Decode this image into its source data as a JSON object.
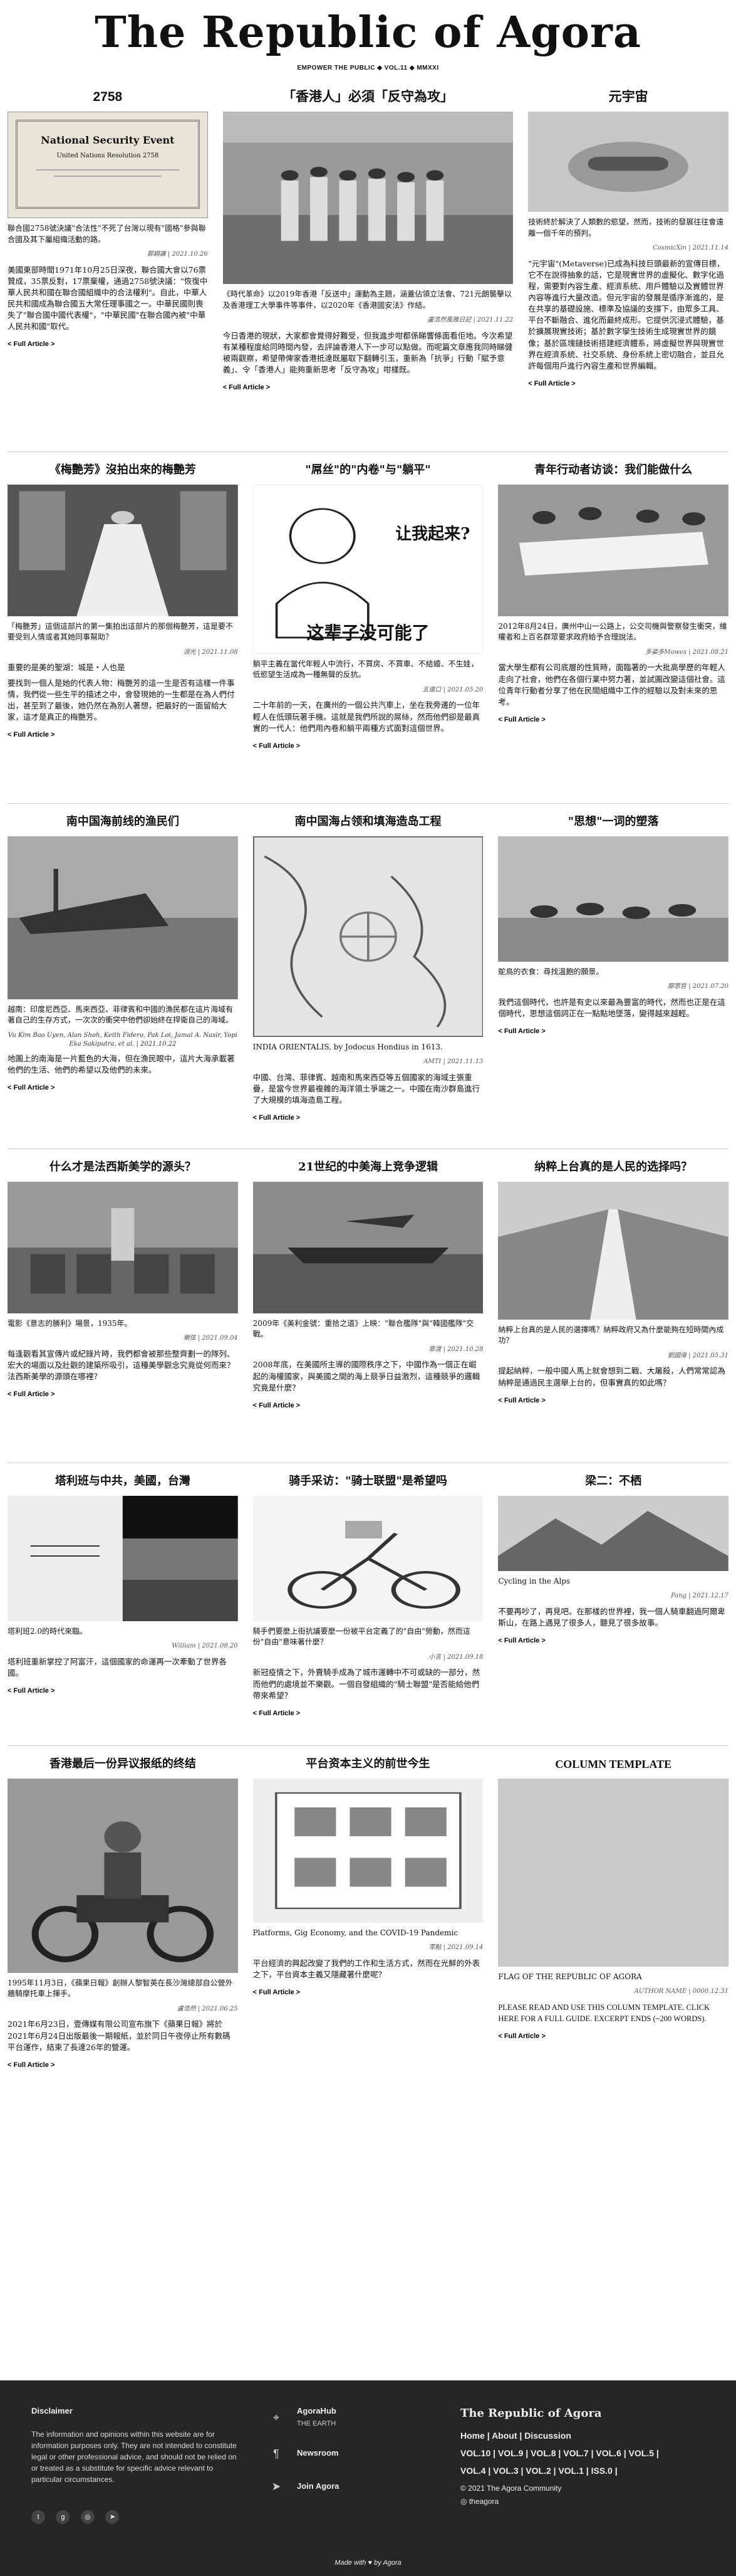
{
  "masthead": {
    "title": "The Republic of Agora",
    "subtitle": "EMPOWER THE PUBLIC ◆ VOL.11 ◆ MMXXI"
  },
  "row1": {
    "left": {
      "title": "2758",
      "image_text": "National Security Event",
      "image_sub": "United Nations Resolution 2758",
      "caption": "聯合國2758號決議\"合法性\"不死了台灣以現有\"國格\"參與聯合國及其下屬組織活動的路。",
      "meta": "鄭穎謙 | 2021.10.26",
      "body": "美國東部時間1971年10月25日深夜，聯合國大會以76票贊成，35票反對，17票棄權，通過2758號決議：\"恢復中華人民共和國在聯合國組織中的合法權利\"。自此，中華人民共和國成為聯合國五大常任理事國之一。中華民國則喪失了\"聯合國中國代表權\"，\"中華民國\"在聯合國內被\"中華人民共和國\"取代。"
    },
    "mid": {
      "title": "「香港人」必須「反守為攻」",
      "caption": "《時代革命》以2019年香港「反送中」運動為主題，涵蓋佔領立法會、721元朗襲擊以及香港理工大學事件等事件，以2020年《香港國安法》作結。",
      "meta": "盧浩然風雅日記 | 2021.11.22",
      "body": "今日香港的現狀，大家都會覺得好難受，但我進步咁都係睇響條面看佢地。今次希望有某種程度給同時間內發，去評論香港人下一步可以點做。而呢篇文章應我同時睇健被兩觀察，希望帶俾家香港抵達既屬取下翻轉引玉，重新為「抗爭」行動「賦予意義」、令「香港人」能夠重新思考「反守為攻」咁樣既。"
    },
    "right": {
      "title": "元宇宙",
      "caption": "技術終於解決了人類數的慾望，然而，技術的發展往往會遠離一個千年的預判。",
      "meta": "CosmicXin | 2021.11.14",
      "body": "\"元宇宙\"(Metaverse)已成為科技巨頭最新的宣傳目標，它不在說得抽象的話，它是現實世界的虛擬化、數字化過程，需要對內容生產、經濟系統、用戶體驗以及實體世界內容等進行大量改造。但元宇宙的發展是循序漸進的，是在共享的基礎設施、標準及協議的支撐下，由眾多工具、平台不斷融合、進化而最終成形。它提供沉浸式體驗，基於擴展現實技術；基於數字孿生技術生成現實世界的鏡像；基於區塊鏈技術搭建經濟體系，將虛擬世界與現實世界在經濟系統、社交系統、身份系統上密切融合，並且允許每個用戶進行內容生產和世界編輯。"
    },
    "full": "< Full Article >"
  },
  "row2": {
    "left": {
      "title": "《梅艷芳》沒拍出來的梅艷芳",
      "caption": "「梅艷芳」這個這部片的第一集拍出這部片的那個梅艷芳，這是要不要受到人情或者其她同事幫助？",
      "meta": "淚光 | 2021.11.08",
      "sub": "重要的是美的聖湖：城是・人也是",
      "body": "要找到一個人是她的代表人物：梅艷芳的這一生是否有這樣一件事情，我們從一些生平的描述之中，會發現她的一生都是在為人們付出，甚至到了最後，她仍然在為別人著想，把最好的一面留給大家，這才是真正的梅艷芳。"
    },
    "mid": {
      "title": "\"屌丝\"的\"内卷\"与\"躺平\"",
      "img_text1": "让我起来?",
      "img_text2": "这辈子没可能了",
      "caption": "躺平主義在當代年輕人中流行，不買房、不買車、不結婚、不生娃，低慾望生活成為一種無聲的反抗。",
      "meta": "五道口 | 2021.05.20",
      "body": "二十年前的一天，在廣州的一個公共汽車上，坐在我旁邊的一位年輕人在低頭玩著手機。這就是我們所說的屌絲，然而他們卻是最真實的一代人：他們用內卷和躺平兩種方式面對這個世界。"
    },
    "right": {
      "title": "青年行动者访谈：我们能做什么",
      "caption": "2012年8月24日，廣州中山一公路上，公交司機與警察發生衝突，維權者和上百名群眾要求政府給予合理說法。",
      "meta": "多姿多Mowes | 2021.08.21",
      "body": "當大學生都有公司底層的性質時，面臨著的一大批高學歷的年輕人走向了社會，他們在各個行業中努力著，並試圖改變這個社會。這位青年行動者分享了他在民間組織中工作的經驗以及對未來的思考。"
    },
    "full": "< Full Article >"
  },
  "row3": {
    "left": {
      "title": "南中国海前线的渔民们",
      "caption": "越南：印度尼西亞、馬來西亞、菲律賓和中國的漁民都在這片海域有著自己的生存方式，一次次的衝突中他們卻始終在捍衛自己的海域。",
      "meta": "Vu Kim Bao Uyen, Alan Shoh, Keith Fidero, Pak Loi, Jamal A. Nasir, Yopi Eka Sakiputra, et al. | 2021.10.22",
      "body": "地圖上的南海是一片藍色的大海，但在漁民眼中，這片大海承載著他們的生活、他們的希望以及他們的未來。"
    },
    "mid": {
      "title": "南中国海占领和填海造岛工程",
      "caption": "INDIA ORIENTALIS, by Jodocus Hondius in 1613.",
      "meta": "AMTI | 2021.11.13",
      "body": "中國、台灣、菲律賓、越南和馬來西亞等五個國家的海域主張重疊，是當今世界最複雜的海洋領土爭端之一。中國在南沙群島進行了大規模的填海造島工程。"
    },
    "right": {
      "title": "\"思想\"一词的塑落",
      "caption": "鴕鳥的衣食：尋找溫飽的願景。",
      "meta": "鄒思哲 | 2021.07.20",
      "body": "我們這個時代，也許是有史以來最為豐富的時代，然而也正是在這個時代，思想這個詞正在一點點地墜落，變得越來越輕。"
    },
    "full": "< Full Article >"
  },
  "row4": {
    "left": {
      "title": "什么才是法西斯美学的源头？",
      "caption": "電影《意志的勝利》場景，1935年。",
      "meta": "樂弦 | 2021.09.04",
      "body": "每逢觀看其宣傳片或紀錄片時，我們都會被那些整齊劃一的隊列、宏大的場面以及壯觀的建築所吸引，這種美學觀念究竟從何而來？法西斯美學的源頭在哪裡？"
    },
    "mid": {
      "title": "21世纪的中美海上竞争逻辑",
      "caption": "2009年《美利金號：重拾之道》上映：\"聯合艦隊\"與\"韓國艦隊\"交戰。",
      "meta": "章渡 | 2021.10.28",
      "body": "2008年底，在美國所主導的國際秩序之下，中國作為一個正在崛起的海權國家，與美國之間的海上競爭日益激烈，這種競爭的邏輯究竟是什麼？"
    },
    "right": {
      "title": "纳粹上台真的是人民的选择吗？",
      "caption": "納粹上台真的是人民的選擇嗎？納粹政府又為什麼能夠在短時間內成功？",
      "meta": "劉國偉 | 2021.05.31",
      "body": "提起納粹，一般中國人馬上就會想到二戰、大屠殺，人們常常認為納粹是通過民主選舉上台的，但事實真的如此嗎？"
    },
    "full": "< Full Article >"
  },
  "row5": {
    "left": {
      "title": "塔利班与中共，美國，台灣",
      "caption": "塔利班2.0的時代來臨。",
      "meta": "William | 2021.08.20",
      "body": "塔利班重新掌控了阿富汗，這個國家的命運再一次牽動了世界各國。"
    },
    "mid": {
      "title": "骑手采访：\"骑士联盟\"是希望吗",
      "caption": "騎手們要麼上街抗議要麼一份被平台定義了的\"自由\"勞動，然而這份\"自由\"意味著什麼？",
      "meta": "小言 | 2021.09.18",
      "body": "新冠疫情之下，外賣騎手成為了城市運轉中不可或缺的一部分，然而他們的處境並不樂觀。一個自發組織的\"騎士聯盟\"是否能給他們帶來希望？"
    },
    "right": {
      "title": "梁二：不栖",
      "caption": "Cycling in the Alps",
      "meta": "Pang | 2021.12.17",
      "body": "不要再吵了，再見吧。在那樣的世界裡，我一個人騎車翻過阿爾卑斯山，在路上遇見了很多人，聽見了很多故事。"
    },
    "full": "< Full Article >"
  },
  "row6": {
    "left": {
      "title": "香港最后一份异议报纸的终结",
      "caption": "1995年11月3日，《蘋果日報》創辦人黎智英在長沙灣總部自公營外牆騎摩托車上揮手。",
      "meta": "盧浩然 | 2021.06.25",
      "body": "2021年6月23日，壹傳媒有限公司宣布旗下《蘋果日報》將於2021年6月24日出版最後一期報紙，並於同日午夜停止所有數碼平台運作，結束了長達26年的營運。"
    },
    "mid": {
      "title": "平台资本主义的前世今生",
      "caption": "Platforms, Gig Economy, and the COVID-19 Pandemic",
      "meta": "零點 | 2021.09.14",
      "body": "平台經濟的興起改變了我們的工作和生活方式，然而在光鮮的外表之下，平台資本主義又隱藏著什麼呢？"
    },
    "right": {
      "title": "COLUMN TEMPLATE",
      "caption": "FLAG OF THE REPUBLIC OF AGORA",
      "meta": "AUTHOR NAME | 0000.12.31",
      "body": "PLEASE READ AND USE THIS COLUMN TEMPLATE. CLICK HERE FOR A FULL GUIDE. EXCERPT ENDS (~200 WORDS)."
    },
    "full": "< Full Article >"
  },
  "footer": {
    "disclaimer_title": "Disclaimer",
    "disclaimer": "The information and opinions within this website are for information purposes only. They are not intended to constitute legal or other professional advice, and should not be relied on or treated as a substitute for specific advice relevant to particular circumstances.",
    "links": [
      {
        "label": "AgoraHub",
        "sub": "THE EARTH"
      },
      {
        "label": "Newsroom",
        "sub": ""
      },
      {
        "label": "Join Agora",
        "sub": ""
      }
    ],
    "brand": "The Republic of Agora",
    "nav": "Home | About | Discussion",
    "vols1": "VOL.10 | VOL.9 | VOL.8 | VOL.7 | VOL.6 | VOL.5 |",
    "vols2": "VOL.4 | VOL.3 | VOL.2 | VOL.1 | ISS.0 |",
    "copyright": "© 2021 The Agora Community",
    "handle": "theagora",
    "madewith": "Made with ♥ by Agora"
  }
}
